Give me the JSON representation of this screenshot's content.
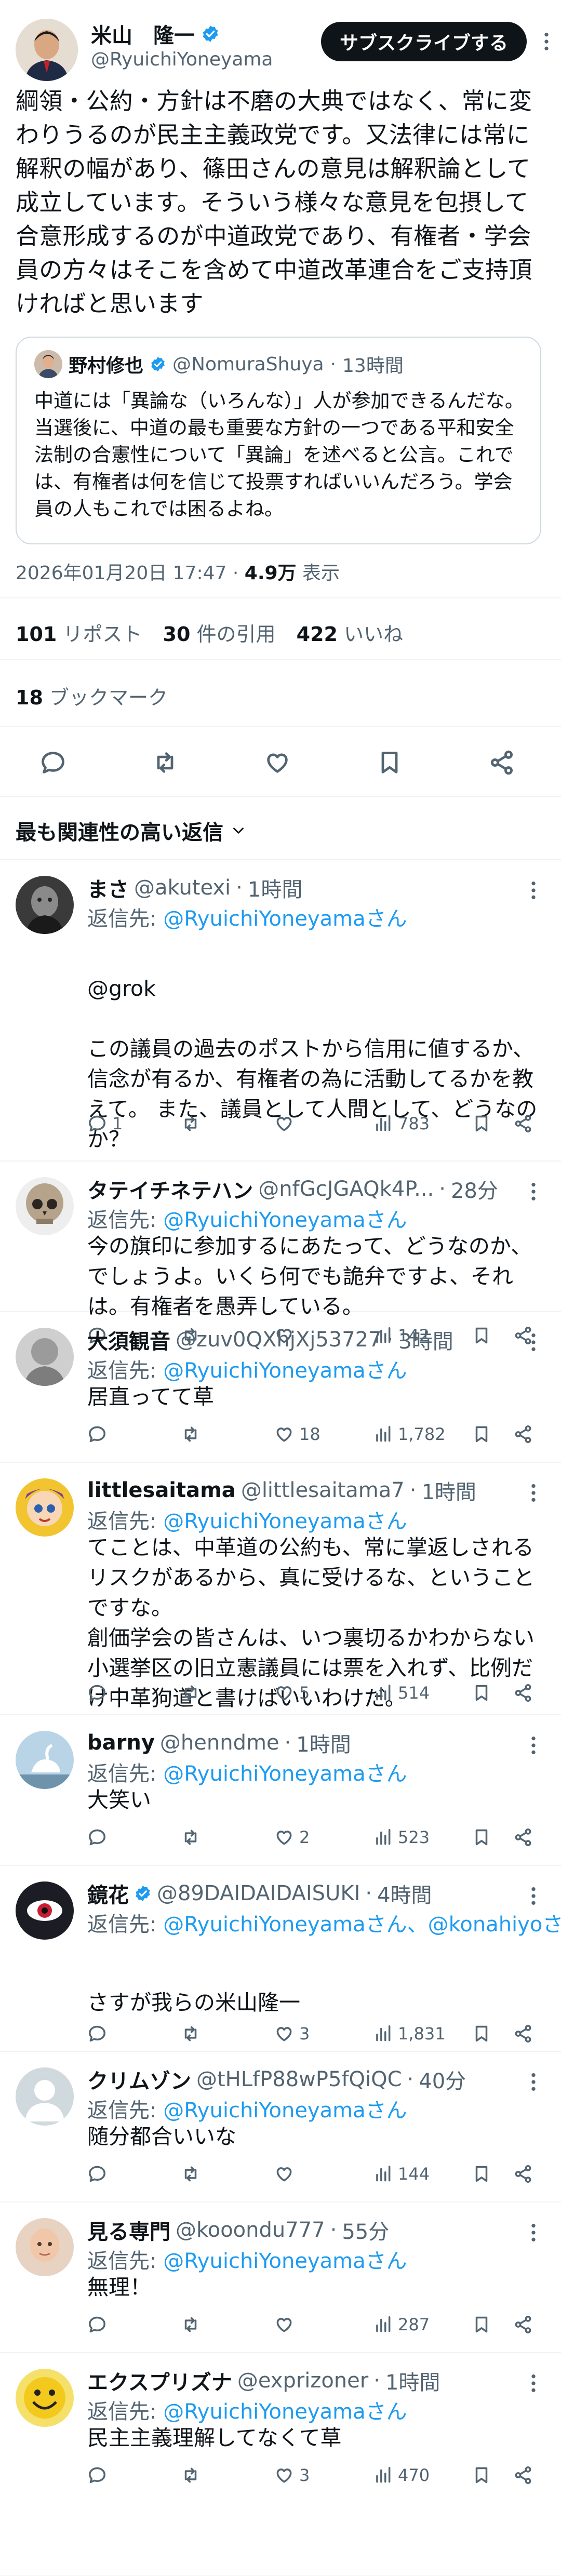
{
  "colors": {
    "accent": "#1d9bf0",
    "text": "#0f1419",
    "muted": "#536471",
    "divider": "#eff3f4",
    "button_bg": "#0f1419"
  },
  "post": {
    "author_name": "米山　隆一",
    "author_handle": "@RyuichiYoneyama",
    "subscribe_label": "サブスクライブする",
    "text": "綱領・公約・方針は不磨の大典ではなく、常に変わりうるのが民主主義政党です。又法律には常に解釈の幅があり、篠田さんの意見は解釈論として成立しています。そういう様々な意見を包摂して合意形成するのが中道政党であり、有権者・学会員の方々はそこを含めて中道改革連合をご支持頂ければと思います",
    "quote": {
      "author_name": "野村修也",
      "author_handle": "@NomuraShuya",
      "time": "13時間",
      "text": "中道には「異論な（いろんな）」人が参加できるんだな。当選後に、中道の最も重要な方針の一つである平和安全法制の合憲性について「異論」を述べると公言。これでは、有権者は何を信じて投票すればいいんだろう。学会員の人もこれでは困るよね。"
    },
    "timestamp": "2026年01月20日 17:47",
    "views_count": "4.9万",
    "views_label": "表示",
    "reposts_count": "101",
    "reposts_label": "リポスト",
    "quotes_count": "30",
    "quotes_label": "件の引用",
    "likes_count": "422",
    "likes_label": "いいね",
    "bookmarks_count": "18",
    "bookmarks_label": "ブックマーク"
  },
  "replies_sort_label": "最も関連性の高い返信",
  "reply_prefix": "返信先: ",
  "replies": [
    {
      "name": "まさ",
      "handle": "@akutexi",
      "time": "1時間",
      "reply_to": "@RyuichiYoneyamaさん",
      "text": "@grok\n\nこの議員の過去のポストから信用に値するか、信念が有るか、有権者の為に活動してるかを教えて。 また、議員として人間として、どうなのか？",
      "replies": "1",
      "retweets": "",
      "likes": "",
      "views": "783"
    },
    {
      "name": "タテイチネテハン",
      "handle": "@nfGcJGAQk4P...",
      "time": "28分",
      "reply_to": "@RyuichiYoneyamaさん",
      "text": "今の旗印に参加するにあたって、どうなのか、でしょうよ。いくら何でも詭弁ですよ、それは。有権者を愚弄している。",
      "replies": "",
      "retweets": "",
      "likes": "",
      "views": "142"
    },
    {
      "name": "大須観音",
      "handle": "@zuv0QXhjXj53727",
      "time": "3時間",
      "reply_to": "@RyuichiYoneyamaさん",
      "text": "居直ってて草",
      "replies": "",
      "retweets": "",
      "likes": "18",
      "views": "1,782"
    },
    {
      "name": "littlesaitama",
      "handle": "@littlesaitama7",
      "time": "1時間",
      "reply_to": "@RyuichiYoneyamaさん",
      "text": "てことは、中革道の公約も、常に掌返しされるリスクがあるから、真に受けるな、ということですな。\n創価学会の皆さんは、いつ裏切るかわからない小選挙区の旧立憲議員には票を入れず、比例だけ中革狗道と書けばいいわけだ。",
      "replies": "",
      "retweets": "",
      "likes": "5",
      "views": "514"
    },
    {
      "name": "barny",
      "handle": "@henndme",
      "time": "1時間",
      "reply_to": "@RyuichiYoneyamaさん",
      "text": "大笑い",
      "replies": "",
      "retweets": "",
      "likes": "2",
      "views": "523"
    },
    {
      "name": "鏡花",
      "handle": "@89DAIDAIDAISUKI",
      "time": "4時間",
      "reply_to": "@RyuichiYoneyamaさん、@konahiyoさん",
      "text": "さすが我らの米山隆一",
      "replies": "",
      "retweets": "",
      "likes": "3",
      "views": "1,831"
    },
    {
      "name": "クリムゾン",
      "handle": "@tHLfP88wP5fQiQC",
      "time": "40分",
      "reply_to": "@RyuichiYoneyamaさん",
      "text": "随分都合いいな",
      "replies": "",
      "retweets": "",
      "likes": "",
      "views": "144"
    },
    {
      "name": "見る専門",
      "handle": "@kooondu777",
      "time": "55分",
      "reply_to": "@RyuichiYoneyamaさん",
      "text": "無理！",
      "replies": "",
      "retweets": "",
      "likes": "",
      "views": "287"
    },
    {
      "name": "エクスプリズナ",
      "handle": "@exprizoner",
      "time": "1時間",
      "reply_to": "@RyuichiYoneyamaさん",
      "text": "民主主義理解してなくて草",
      "replies": "",
      "retweets": "",
      "likes": "3",
      "views": "470"
    }
  ]
}
